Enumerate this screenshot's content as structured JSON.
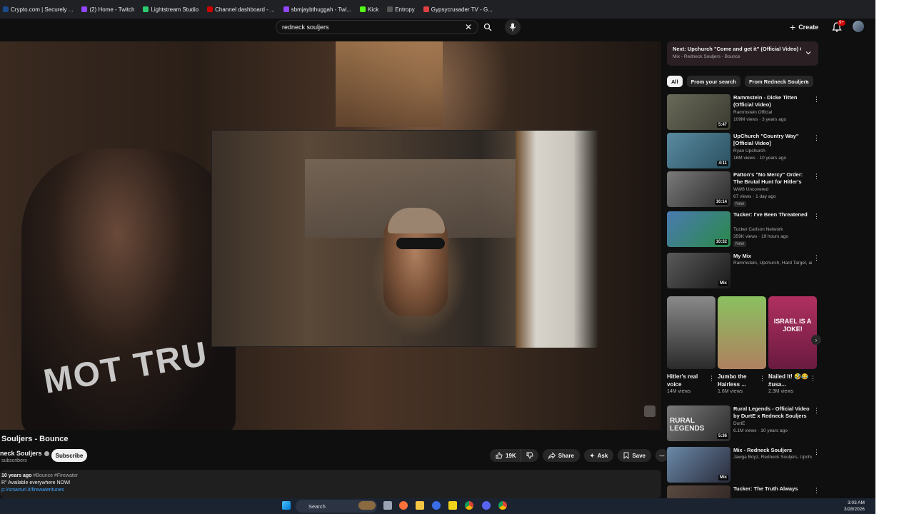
{
  "bookmarks": [
    {
      "label": "Crypto.com | Securely ...",
      "color": "#1a4b8c"
    },
    {
      "label": "(2) Home - Twitch",
      "color": "#9146ff"
    },
    {
      "label": "Lightstream Studio",
      "color": "#2ecc71"
    },
    {
      "label": "Channel dashboard - ...",
      "color": "#cc0000"
    },
    {
      "label": "sbmjaybthuggah - Twi...",
      "color": "#9146ff"
    },
    {
      "label": "Kick",
      "color": "#53fc18"
    },
    {
      "label": "Entropy",
      "color": "#555555"
    },
    {
      "label": "Gypsycrusader TV - G...",
      "color": "#e04040"
    }
  ],
  "search": {
    "query": "redneck souljers",
    "clear_icon": "close-icon",
    "search_icon": "search-icon",
    "mic_icon": "mic-icon"
  },
  "masthead": {
    "create_label": "Create",
    "bell_badge": "9+"
  },
  "video": {
    "shirt_text": "MOT TRU",
    "title": "Souljers - Bounce",
    "channel": "neck Souljers",
    "subscribers": "subscribers",
    "subscribe_label": "Subscribe",
    "likes": "19K",
    "share_label": "Share",
    "ask_label": "Ask",
    "save_label": "Save",
    "description": {
      "age": "10 years ago",
      "hashtags": "#Bounce #Firewater",
      "line2": "R\" Available everywhere NOW!",
      "link": "p://smarturl.it/firewateritunes"
    }
  },
  "next_up": {
    "label": "Next:",
    "title": "Upchurch \"Come and get it\" (Official Video) C...",
    "subtitle": "Mix - Redneck Souljers - Bounce"
  },
  "chips": [
    "All",
    "From your search",
    "From Redneck Souljers"
  ],
  "recommendations": [
    {
      "title": "Rammstein - Dicke Titten (Official Video)",
      "channel": "Rammstein Official",
      "verified": true,
      "stats": "109M views · 3 years ago",
      "duration": "5:47",
      "new": false,
      "thumb": [
        "#6a6a5a",
        "#3a3a30"
      ]
    },
    {
      "title": "UpChurch \"Country Way\" [Official Video]",
      "channel": "Ryan Upchurch",
      "verified": true,
      "stats": "16M views · 10 years ago",
      "duration": "4:11",
      "new": false,
      "thumb": [
        "#5a8aa0",
        "#2a5060"
      ]
    },
    {
      "title": "Patton's \"No Mercy\" Order: The Brutal Hunt for Hitler's Secret ...",
      "channel": "WW8 Uncovered",
      "verified": false,
      "stats": "67 views · 1 day ago",
      "duration": "16:14",
      "new": true,
      "new_label": "New",
      "thumb": [
        "#7a7a7a",
        "#2a2a2a"
      ]
    },
    {
      "title": "Tucker: I've Been Threatened",
      "channel": "Tucker Carlson Network",
      "verified": false,
      "stats": "359K views · 19 hours ago",
      "duration": "10:32",
      "new": true,
      "new_label": "New",
      "thumb": [
        "#4a7ab0",
        "#2a8a4a"
      ]
    },
    {
      "title": "My Mix",
      "channel": "Rammstein, Upchurch, Hard Target, and ...",
      "verified": false,
      "stats": "",
      "duration": "Mix",
      "new": false,
      "thumb": [
        "#5a5a5a",
        "#1a1a1a"
      ]
    }
  ],
  "shorts": [
    {
      "title": "Hitler's real voice",
      "views": "14M views",
      "thumb": [
        "#8a8a8a",
        "#2a2a2a"
      ]
    },
    {
      "title": "Jumbo the Hairless ...",
      "views": "1.6M views",
      "thumb": [
        "#8ac060",
        "#b08060"
      ]
    },
    {
      "title": "Nailed It! 🤣😂 #usa...",
      "views": "2.3M views",
      "thumb_text": "ISRAEL IS A JOKE!",
      "thumb": [
        "#b03060",
        "#6a1a40"
      ]
    }
  ],
  "recommendations_after": [
    {
      "title": "Rural Legends - Official Video by DurtE x Redneck Souljers",
      "channel": "DurtE",
      "verified": true,
      "stats": "6.1M views · 10 years ago",
      "duration": "5:36",
      "thumb_text": "RURAL LEGENDS",
      "thumb": [
        "#7a7a7a",
        "#2a2a2a"
      ]
    },
    {
      "title": "Mix - Redneck Souljers",
      "channel": "Jawga Boyz, Redneck Souljers, Upchurch...",
      "verified": false,
      "stats": "",
      "duration": "Mix",
      "thumb": [
        "#6a8aa8",
        "#2a2a3a"
      ]
    },
    {
      "title": "Tucker: The Truth Always",
      "channel": "",
      "verified": false,
      "stats": "",
      "duration": "",
      "thumb": [
        "#5a4a40",
        "#2a2020"
      ]
    }
  ],
  "taskbar": {
    "search_label": "Search",
    "time": "3:03 AM",
    "date": "3/28/2026",
    "icons": [
      "windows-start-icon",
      "task-view-icon",
      "firefox-icon",
      "file-explorer-icon",
      "edge-icon",
      "norton-icon",
      "chrome-icon",
      "discord-icon",
      "chrome-alt-icon"
    ]
  },
  "colors": {
    "background": "#0f0f0f",
    "accent_red": "#cc0000",
    "link_blue": "#3ea6ff"
  }
}
